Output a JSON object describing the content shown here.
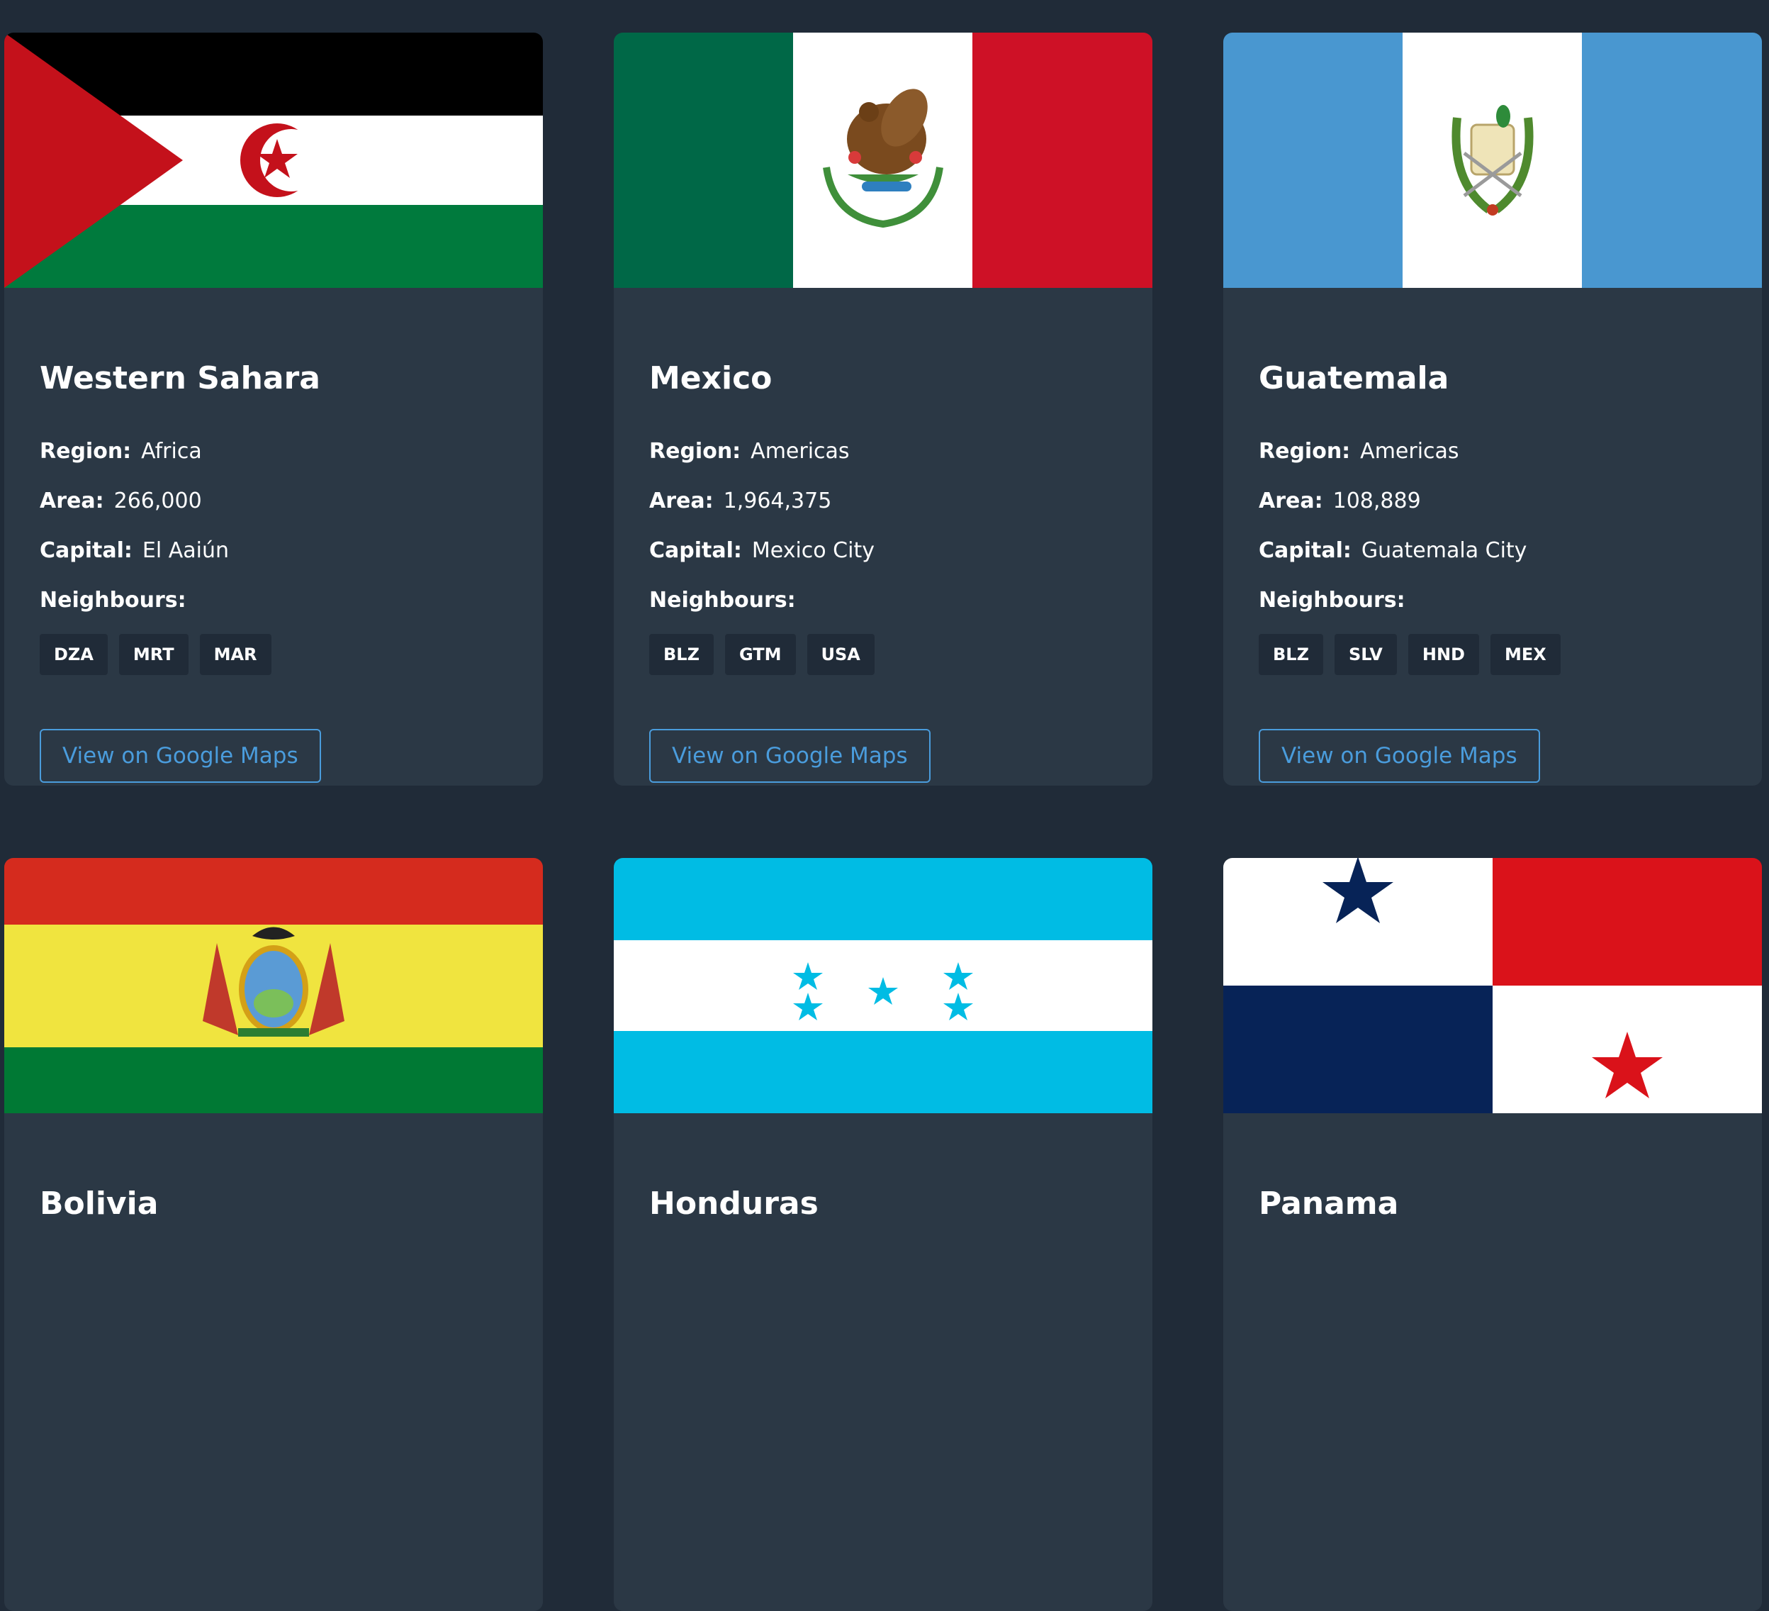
{
  "labels": {
    "region": "Region:",
    "area": "Area:",
    "capital": "Capital:",
    "neighbours": "Neighbours:",
    "maps_button": "View on Google Maps"
  },
  "countries": [
    {
      "name": "Western Sahara",
      "region": "Africa",
      "area": "266,000",
      "capital": "El Aaiún",
      "neighbours": [
        "DZA",
        "MRT",
        "MAR"
      ],
      "flag_icon": "western-sahara-flag"
    },
    {
      "name": "Mexico",
      "region": "Americas",
      "area": "1,964,375",
      "capital": "Mexico City",
      "neighbours": [
        "BLZ",
        "GTM",
        "USA"
      ],
      "flag_icon": "mexico-flag"
    },
    {
      "name": "Guatemala",
      "region": "Americas",
      "area": "108,889",
      "capital": "Guatemala City",
      "neighbours": [
        "BLZ",
        "SLV",
        "HND",
        "MEX"
      ],
      "flag_icon": "guatemala-flag"
    },
    {
      "name": "Bolivia",
      "flag_icon": "bolivia-flag"
    },
    {
      "name": "Honduras",
      "flag_icon": "honduras-flag"
    },
    {
      "name": "Panama",
      "flag_icon": "panama-flag"
    }
  ],
  "colors": {
    "page_background": "#202b38",
    "card_background": "#2b3845",
    "chip_background": "#202b38",
    "accent": "#4a9cdc",
    "text": "#ffffff"
  }
}
